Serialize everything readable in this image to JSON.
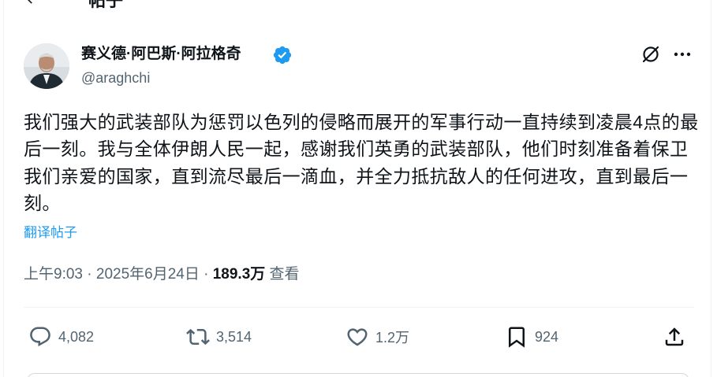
{
  "header": {
    "title": "帖子"
  },
  "author": {
    "display_name": "赛义德·阿巴斯·阿拉格奇",
    "handle": "@araghchi"
  },
  "post": {
    "text": "我们强大的武装部队为惩罚以色列的侵略而展开的军事行动一直持续到凌晨4点的最后一刻。我与全体伊朗人民一起，感谢我们英勇的武装部队，他们时刻准备着保卫我们亲爱的国家，直到流尽最后一滴血，并全力抵抗敌人的任何进攻，直到最后一刻。",
    "translate_label": "翻译帖子",
    "time": "上午9:03",
    "separator": " · ",
    "date": "2025年6月24日",
    "separator2": " · ",
    "views": "189.3万",
    "views_label": " 查看"
  },
  "actions": {
    "reply_count": "4,082",
    "repost_count": "3,514",
    "like_count": "1.2万",
    "bookmark_count": "924"
  },
  "icons": {
    "back": "arrow-left-icon",
    "verified": "verified-badge-icon",
    "grok": "grok-icon",
    "more": "more-horizontal-icon",
    "reply": "reply-icon",
    "repost": "repost-icon",
    "like": "heart-icon",
    "bookmark": "bookmark-icon",
    "share": "share-icon"
  },
  "colors": {
    "accent": "#1d9bf0",
    "text": "#0f1419",
    "secondary": "#536471"
  }
}
